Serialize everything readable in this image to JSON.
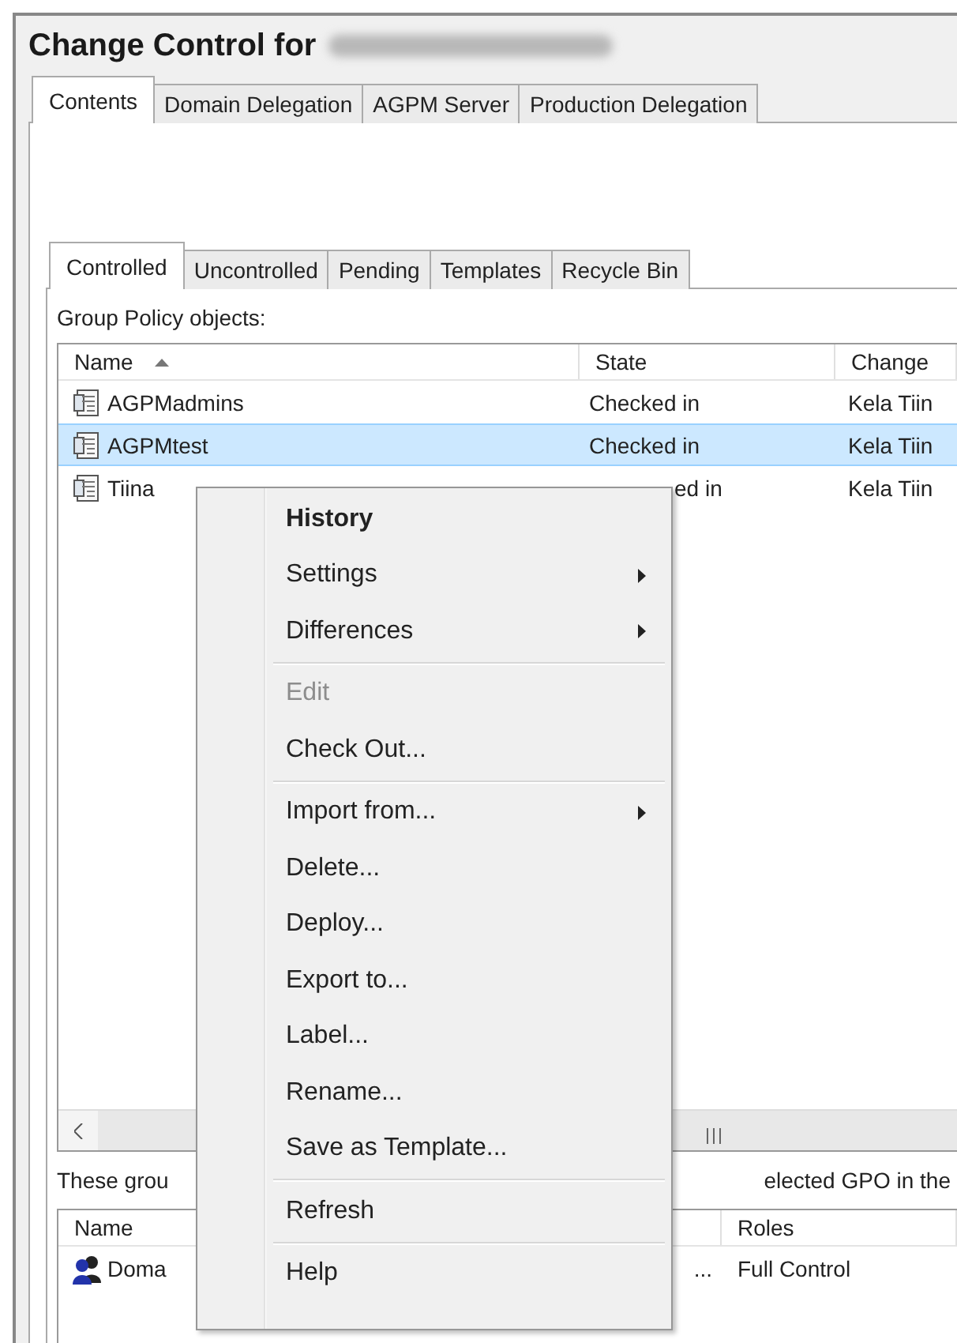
{
  "window": {
    "title": "Change Control for"
  },
  "tabs": [
    {
      "label": "Contents",
      "selected": true
    },
    {
      "label": "Domain Delegation",
      "selected": false
    },
    {
      "label": "AGPM Server",
      "selected": false
    },
    {
      "label": "Production Delegation",
      "selected": false
    }
  ],
  "subtabs": [
    {
      "label": "Controlled",
      "selected": true
    },
    {
      "label": "Uncontrolled",
      "selected": false
    },
    {
      "label": "Pending",
      "selected": false
    },
    {
      "label": "Templates",
      "selected": false
    },
    {
      "label": "Recycle Bin",
      "selected": false
    }
  ],
  "gpo_list": {
    "label": "Group Policy objects:",
    "columns": [
      "Name",
      "State",
      "Change"
    ],
    "rows": [
      {
        "name": "AGPMadmins",
        "state": "Checked in",
        "changed_by": "Kela Tiin",
        "selected": false
      },
      {
        "name": "AGPMtest",
        "state": "Checked in",
        "changed_by": "Kela Tiin",
        "selected": true
      },
      {
        "name": "Tiina",
        "state": "ed in",
        "changed_by": "Kela Tiin",
        "selected": false
      }
    ]
  },
  "groups_note": {
    "left": "These grou",
    "right": "elected GPO in the"
  },
  "groups_list": {
    "columns": [
      "Name",
      "Roles"
    ],
    "rows": [
      {
        "name": "Doma",
        "column_2": "...",
        "roles": "Full Control"
      }
    ]
  },
  "context_menu": [
    {
      "kind": "item",
      "label": "History",
      "bold": true,
      "disabled": false,
      "submenu": false
    },
    {
      "kind": "item",
      "label": "Settings",
      "bold": false,
      "disabled": false,
      "submenu": true
    },
    {
      "kind": "item",
      "label": "Differences",
      "bold": false,
      "disabled": false,
      "submenu": true
    },
    {
      "kind": "separator"
    },
    {
      "kind": "item",
      "label": "Edit",
      "bold": false,
      "disabled": true,
      "submenu": false
    },
    {
      "kind": "item",
      "label": "Check Out...",
      "bold": false,
      "disabled": false,
      "submenu": false
    },
    {
      "kind": "separator"
    },
    {
      "kind": "item",
      "label": "Import from...",
      "bold": false,
      "disabled": false,
      "submenu": true
    },
    {
      "kind": "item",
      "label": "Delete...",
      "bold": false,
      "disabled": false,
      "submenu": false
    },
    {
      "kind": "item",
      "label": "Deploy...",
      "bold": false,
      "disabled": false,
      "submenu": false
    },
    {
      "kind": "item",
      "label": "Export to...",
      "bold": false,
      "disabled": false,
      "submenu": false
    },
    {
      "kind": "item",
      "label": "Label...",
      "bold": false,
      "disabled": false,
      "submenu": false
    },
    {
      "kind": "item",
      "label": "Rename...",
      "bold": false,
      "disabled": false,
      "submenu": false
    },
    {
      "kind": "item",
      "label": "Save as Template...",
      "bold": false,
      "disabled": false,
      "submenu": false
    },
    {
      "kind": "separator"
    },
    {
      "kind": "item",
      "label": "Refresh",
      "bold": false,
      "disabled": false,
      "submenu": false
    },
    {
      "kind": "separator"
    },
    {
      "kind": "item",
      "label": "Help",
      "bold": false,
      "disabled": false,
      "submenu": false
    }
  ]
}
